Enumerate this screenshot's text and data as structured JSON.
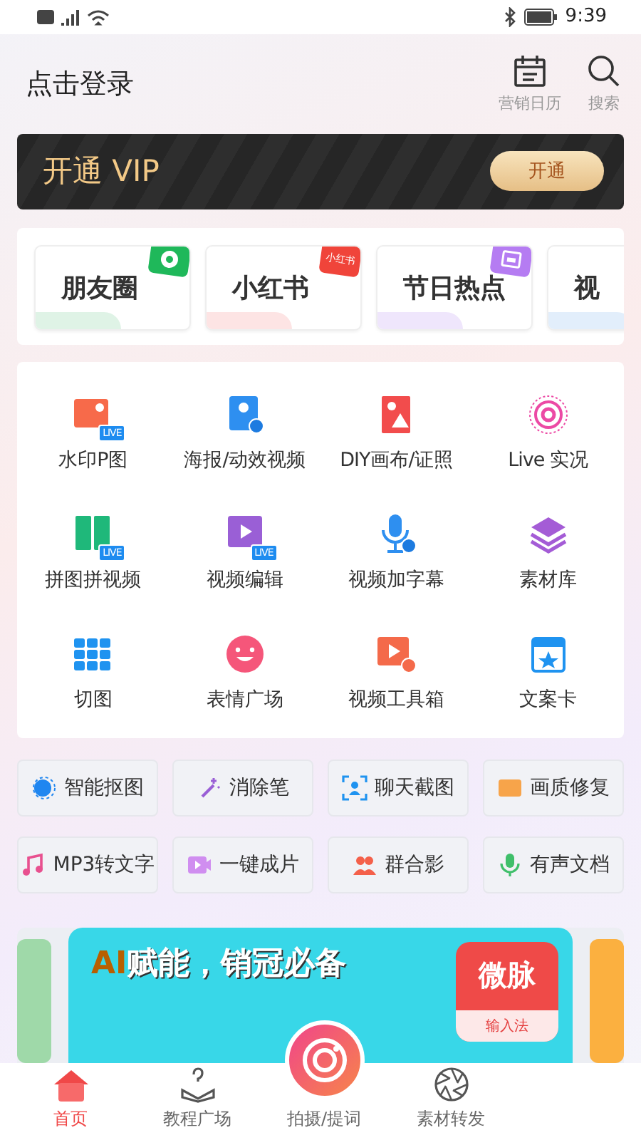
{
  "status_bar": {
    "time": "9:39"
  },
  "header": {
    "login": "点击登录",
    "actions": [
      {
        "label": "营销日历",
        "kind": "calendar"
      },
      {
        "label": "搜索",
        "kind": "search"
      }
    ]
  },
  "vip": {
    "title": "开通 VIP",
    "button": "开通"
  },
  "scenes": [
    {
      "label": "朋友圈",
      "color": "#dff3e6",
      "kind": "shutter"
    },
    {
      "label": "小红书",
      "color": "#fde4e4",
      "kind": "text",
      "badge": "小红书"
    },
    {
      "label": "节日热点",
      "color": "#efe6fc",
      "kind": "calendar"
    },
    {
      "label": "视",
      "color": "#e2eefb",
      "kind": "plain"
    }
  ],
  "tools": [
    {
      "label": "水印P图",
      "badge": "LIVE"
    },
    {
      "label": "海报/动效视频"
    },
    {
      "label": "DIY画布/证照"
    },
    {
      "label": "Live 实况"
    },
    {
      "label": "拼图拼视频",
      "badge": "LIVE"
    },
    {
      "label": "视频编辑",
      "badge": "LIVE"
    },
    {
      "label": "视频加字幕"
    },
    {
      "label": "素材库"
    },
    {
      "label": "切图"
    },
    {
      "label": "表情广场"
    },
    {
      "label": "视频工具箱"
    },
    {
      "label": "文案卡"
    }
  ],
  "chips": [
    {
      "label": "智能抠图"
    },
    {
      "label": "消除笔"
    },
    {
      "label": "聊天截图"
    },
    {
      "label": "画质修复"
    },
    {
      "label": "MP3转文字"
    },
    {
      "label": "一键成片"
    },
    {
      "label": "群合影"
    },
    {
      "label": "有声文档"
    }
  ],
  "banner": {
    "accent": "AI",
    "headline": "赋能，销冠必备",
    "app_name": "微脉",
    "app_tag": "输入法"
  },
  "tab_bar": [
    {
      "label": "首页",
      "selected": true,
      "kind": "home"
    },
    {
      "label": "教程广场",
      "selected": false,
      "kind": "tutorial"
    },
    {
      "label": "拍摄/提词",
      "selected": false,
      "kind": "camera"
    },
    {
      "label": "素材转发",
      "selected": false,
      "kind": "aperture"
    }
  ]
}
